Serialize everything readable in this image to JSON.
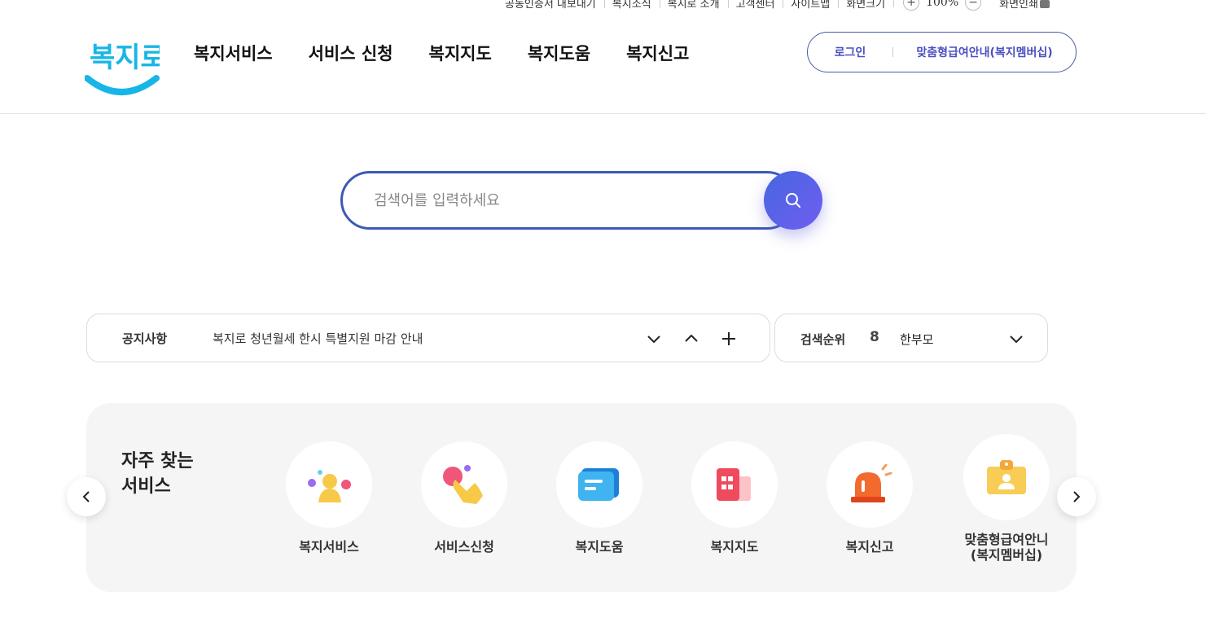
{
  "utility": {
    "items": [
      "공동인증서 내보내기",
      "복지소식",
      "복지로 소개",
      "고객센터",
      "사이트맵",
      "화면크기"
    ],
    "zoom_value": "100%",
    "print_label": "화면인쇄"
  },
  "header": {
    "logo_text": "복지로",
    "nav": [
      "복지서비스",
      "서비스 신청",
      "복지지도",
      "복지도움",
      "복지신고"
    ],
    "login_label": "로그인",
    "member_label": "맞춤형급여안내(복지멤버십)"
  },
  "search": {
    "placeholder": "검색어를 입력하세요"
  },
  "notice": {
    "label": "공지사항",
    "text": "복지로 청년월세 한시 특별지원 마감 안내"
  },
  "ranking": {
    "label": "검색순위",
    "number": "8",
    "keyword": "한부모"
  },
  "frequent": {
    "title_line1": "자주 찾는",
    "title_line2": "서비스",
    "items": [
      {
        "label": "복지서비스",
        "icon": "person-icon"
      },
      {
        "label": "서비스신청",
        "icon": "hand-tap-icon"
      },
      {
        "label": "복지도움",
        "icon": "message-icon"
      },
      {
        "label": "복지지도",
        "icon": "map-icon"
      },
      {
        "label": "복지신고",
        "icon": "siren-icon"
      },
      {
        "label": "맞춤형급여안니\n(복지멤버십)",
        "label_line1": "맞춤형급여안니",
        "label_line2": "(복지멤버십)",
        "icon": "id-card-icon"
      }
    ]
  },
  "colors": {
    "brand_blue": "#3d5ab8",
    "accent_purple": "#6f5ef0",
    "logo_cyan": "#17b6e6"
  }
}
